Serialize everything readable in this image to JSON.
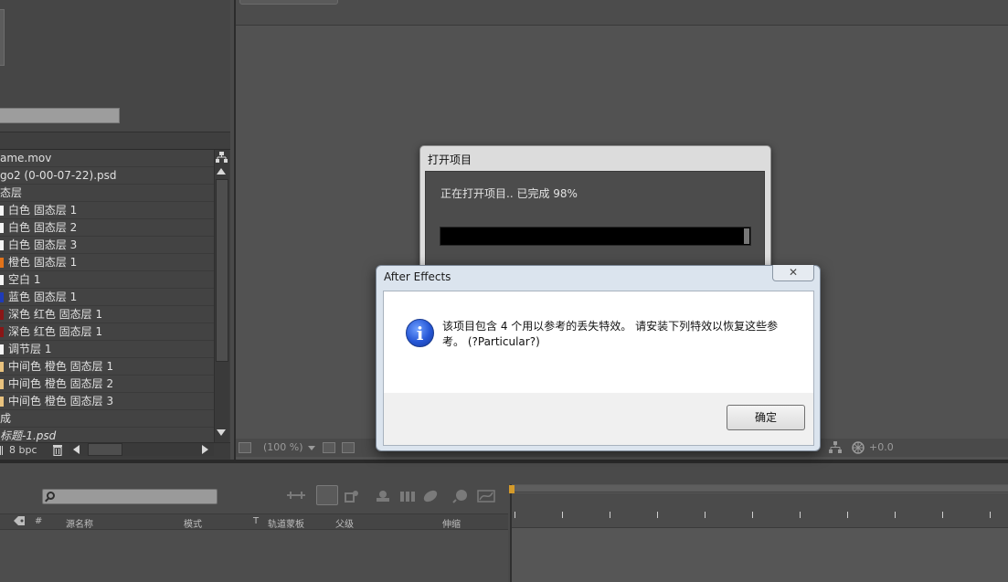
{
  "project_panel": {
    "items": [
      {
        "label": "ame.mov",
        "swatch": null,
        "italic": false
      },
      {
        "label": "go2 (0-00-07-22).psd",
        "swatch": null,
        "italic": false
      },
      {
        "label": "态层",
        "swatch": null,
        "italic": false
      },
      {
        "label": "白色 固态层 1",
        "swatch": "#f4f4f4",
        "italic": false
      },
      {
        "label": "白色 固态层 2",
        "swatch": "#f4f4f4",
        "italic": false
      },
      {
        "label": "白色 固态层 3",
        "swatch": "#f4f4f4",
        "italic": false
      },
      {
        "label": "橙色 固态层 1",
        "swatch": "#e2731a",
        "italic": false
      },
      {
        "label": "空白 1",
        "swatch": "#f4f4f4",
        "italic": false
      },
      {
        "label": "蓝色 固态层 1",
        "swatch": "#1f3bb8",
        "italic": false
      },
      {
        "label": "深色 红色 固态层 1",
        "swatch": "#8a1616",
        "italic": false
      },
      {
        "label": "深色 红色 固态层 1",
        "swatch": "#8a1616",
        "italic": false
      },
      {
        "label": "调节层 1",
        "swatch": "#f4f4f4",
        "italic": false
      },
      {
        "label": "中间色 橙色 固态层 1",
        "swatch": "#e8c27e",
        "italic": false
      },
      {
        "label": "中间色 橙色 固态层 2",
        "swatch": "#e8c27e",
        "italic": false
      },
      {
        "label": "中间色 橙色 固态层 3",
        "swatch": "#e8c27e",
        "italic": false
      },
      {
        "label": "成",
        "swatch": null,
        "italic": false
      },
      {
        "label": "标题-1.psd",
        "swatch": null,
        "italic": true
      }
    ],
    "bit_depth": "8 bpc",
    "icons": [
      "flowchart-icon",
      "trash-icon"
    ]
  },
  "viewer": {
    "zoom": "(100 %)",
    "exposure": "+0.0"
  },
  "timeline": {
    "columns": {
      "num": "#",
      "source_name": "源名称",
      "mode": "模式",
      "t": "T",
      "track_matte": "轨道蒙板",
      "parent": "父级",
      "stretch": "伸缩"
    },
    "search_placeholder": ""
  },
  "progress_dialog": {
    "title": "打开项目",
    "status": "正在打开项目.. 已完成 98%",
    "progress": 0.98
  },
  "alert_dialog": {
    "title": "After Effects",
    "close_glyph": "✕",
    "message": "该项目包含 4 个用以参考的丢失特效。 请安装下列特效以恢复这些参考。 (?Particular?)",
    "ok_label": "确定"
  },
  "colors": {
    "accent_orange": "#d49a2a",
    "info_blue": "#2657d6"
  }
}
